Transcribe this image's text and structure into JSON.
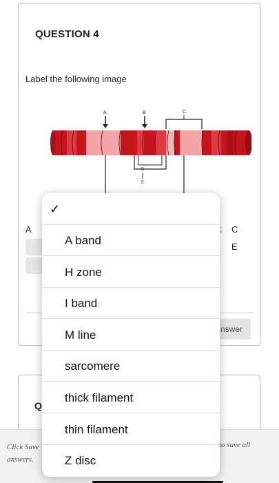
{
  "question": {
    "heading": "QUESTION 4",
    "prompt": "Label the following image"
  },
  "diagram": {
    "labels": [
      "A",
      "B",
      "C",
      "D",
      "E"
    ],
    "colors": {
      "dark_red": "#c4161c",
      "mid_red": "#df3a43",
      "pink": "#f4a3a6",
      "edge_dark": "#8e0f14"
    }
  },
  "answer_area": {
    "left_label": "A",
    "right_label_top": "C",
    "right_label_bottom": "E",
    "semicolon": ";",
    "answer_button": "nswer"
  },
  "next_question_letter": "Q",
  "footer": {
    "left_text": "Click Save answers.",
    "right_text": "to save all"
  },
  "dropdown": {
    "check_icon": "checkmark-icon",
    "check_glyph": "✓",
    "options": [
      "A band",
      "H zone",
      "I band",
      "M line",
      "sarcomere",
      "thick filament",
      "thin filament",
      "Z disc"
    ]
  }
}
